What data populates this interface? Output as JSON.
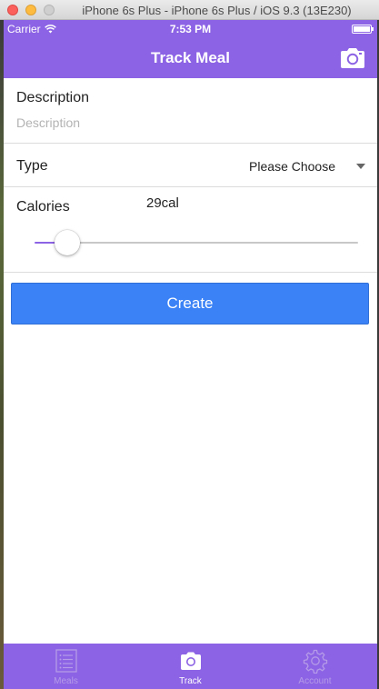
{
  "window": {
    "title": "iPhone 6s Plus - iPhone 6s Plus / iOS 9.3 (13E230)"
  },
  "status_bar": {
    "carrier": "Carrier",
    "time": "7:53 PM"
  },
  "nav_bar": {
    "title": "Track Meal",
    "right_icon": "camera-icon"
  },
  "form": {
    "description": {
      "label": "Description",
      "value": "",
      "placeholder": "Description"
    },
    "type": {
      "label": "Type",
      "selected": "Please Choose"
    },
    "calories": {
      "label": "Calories",
      "value_text": "29cal",
      "slider_fraction": 0.03
    },
    "create_label": "Create"
  },
  "tab_bar": {
    "items": [
      {
        "label": "Meals",
        "icon": "list-icon",
        "active": false
      },
      {
        "label": "Track",
        "icon": "camera-icon",
        "active": true
      },
      {
        "label": "Account",
        "icon": "gear-icon",
        "active": false
      }
    ]
  },
  "colors": {
    "accent": "#8c63e4",
    "button": "#3b82f6",
    "inactive_tab": "#b59be8"
  }
}
